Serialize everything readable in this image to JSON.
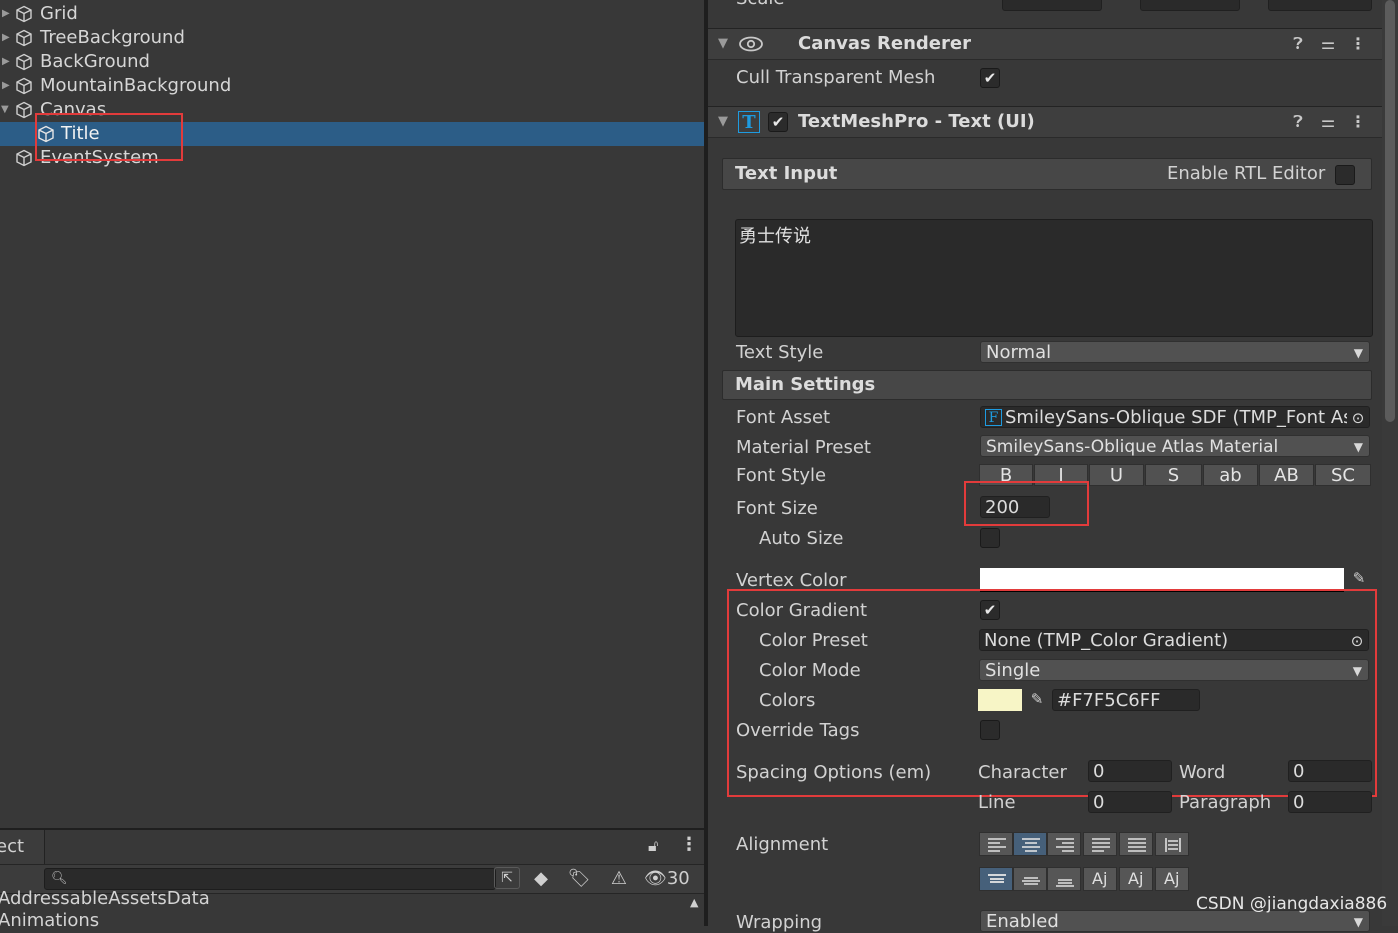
{
  "hierarchy": {
    "items": [
      {
        "label": "Grid"
      },
      {
        "label": "TreeBackground"
      },
      {
        "label": "BackGround"
      },
      {
        "label": "MountainBackground"
      },
      {
        "label": "Canvas"
      },
      {
        "label": "Title"
      },
      {
        "label": "EventSystem"
      }
    ]
  },
  "project": {
    "tab_label": "ect",
    "filter_count": "30",
    "files": [
      "AddressableAssetsData",
      "Animations"
    ]
  },
  "inspector": {
    "scale_label": "Scale",
    "canvas_renderer": {
      "title": "Canvas Renderer",
      "cull_label": "Cull Transparent Mesh",
      "cull_checked": true
    },
    "tmp": {
      "title": "TextMeshPro - Text (UI)",
      "icon_letter": "T",
      "enabled": true,
      "text_input_header": "Text Input",
      "rtl_label": "Enable RTL Editor",
      "text_value": "勇士传说",
      "text_style_label": "Text Style",
      "text_style_value": "Normal",
      "main_settings_header": "Main Settings",
      "font_asset_label": "Font Asset",
      "font_asset_icon": "F",
      "font_asset_value": "SmileySans-Oblique SDF (TMP_Font Asset)",
      "material_preset_label": "Material Preset",
      "material_preset_value": "SmileySans-Oblique Atlas Material",
      "font_style_label": "Font Style",
      "font_style_buttons": [
        "B",
        "I",
        "U",
        "S",
        "ab",
        "AB",
        "SC"
      ],
      "font_size_label": "Font Size",
      "font_size_value": "200",
      "auto_size_label": "Auto Size",
      "vertex_color_label": "Vertex Color",
      "vertex_color": "#FFFFFF",
      "color_gradient_label": "Color Gradient",
      "color_gradient_checked": true,
      "color_preset_label": "Color Preset",
      "color_preset_value": "None (TMP_Color Gradient)",
      "color_mode_label": "Color Mode",
      "color_mode_value": "Single",
      "colors_label": "Colors",
      "colors_swatch": "#F7F5C6",
      "colors_hex": "#F7F5C6FF",
      "override_tags_label": "Override Tags",
      "spacing_label": "Spacing Options (em)",
      "character_label": "Character",
      "character_value": "0",
      "word_label": "Word",
      "word_value": "0",
      "line_label": "Line",
      "line_value": "0",
      "paragraph_label": "Paragraph",
      "paragraph_value": "0",
      "alignment_label": "Alignment",
      "wrapping_label": "Wrapping",
      "wrapping_value": "Enabled"
    }
  },
  "watermark": "CSDN @jiangdaxia886",
  "colors": {
    "selection": "#2C5D87",
    "highlight_border": "#E23B3B",
    "tmp_icon": "#1E9BE0"
  }
}
